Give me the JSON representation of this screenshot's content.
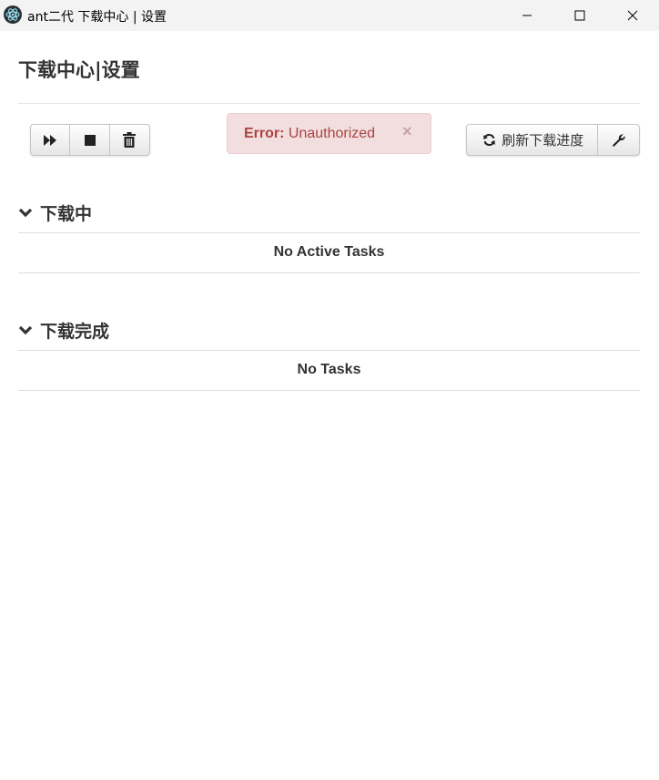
{
  "window": {
    "title": "ant二代 下载中心 | 设置",
    "controls": [
      "minimize-icon",
      "maximize-icon",
      "close-icon"
    ]
  },
  "page": {
    "title": "下载中心|设置"
  },
  "toolbar": {
    "left_buttons": [
      "fast-forward-icon",
      "stop-icon",
      "trash-icon"
    ],
    "refresh_label": "刷新下载进度",
    "refresh_icon": "refresh-icon",
    "settings_icon": "wrench-icon"
  },
  "alert": {
    "strong": "Error:",
    "message": "Unauthorized",
    "close": "×",
    "colors": {
      "text": "#a94442",
      "background": "#f2dede",
      "border": "#ebccd1"
    }
  },
  "sections": {
    "downloading": {
      "title": "下载中",
      "empty_message": "No Active Tasks",
      "icon": "chevron-down-icon"
    },
    "completed": {
      "title": "下载完成",
      "empty_message": "No Tasks",
      "icon": "chevron-down-icon"
    }
  }
}
